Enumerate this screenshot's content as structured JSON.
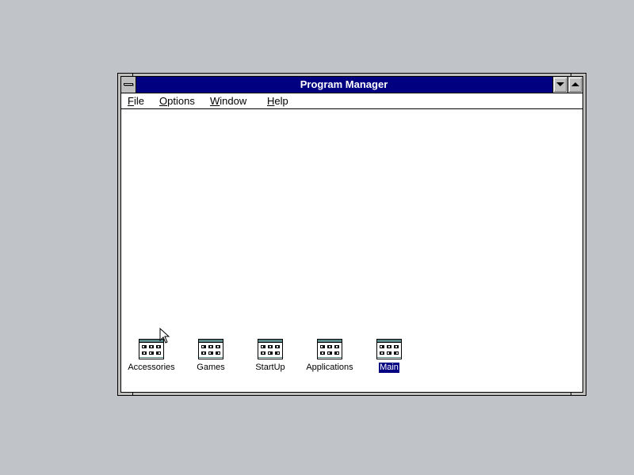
{
  "window": {
    "title": "Program Manager",
    "title_color": "#000080",
    "controls": [
      "system-menu",
      "minimize",
      "maximize"
    ]
  },
  "menubar": {
    "items": [
      {
        "label": "File",
        "mnemonic": "F",
        "rest": "ile"
      },
      {
        "label": "Options",
        "mnemonic": "O",
        "rest": "ptions"
      },
      {
        "label": "Window",
        "mnemonic": "W",
        "rest": "indow"
      },
      {
        "label": "Help",
        "mnemonic": "H",
        "rest": "elp"
      }
    ]
  },
  "groups": [
    {
      "label": "Accessories",
      "icon": "program-group-icon",
      "selected": false
    },
    {
      "label": "Games",
      "icon": "program-group-icon",
      "selected": false
    },
    {
      "label": "StartUp",
      "icon": "program-group-icon",
      "selected": false
    },
    {
      "label": "Applications",
      "icon": "program-group-icon",
      "selected": false
    },
    {
      "label": "Main",
      "icon": "program-group-icon",
      "selected": true
    }
  ],
  "colors": {
    "desktop": "#c0c4c8",
    "selection": "#000080"
  }
}
